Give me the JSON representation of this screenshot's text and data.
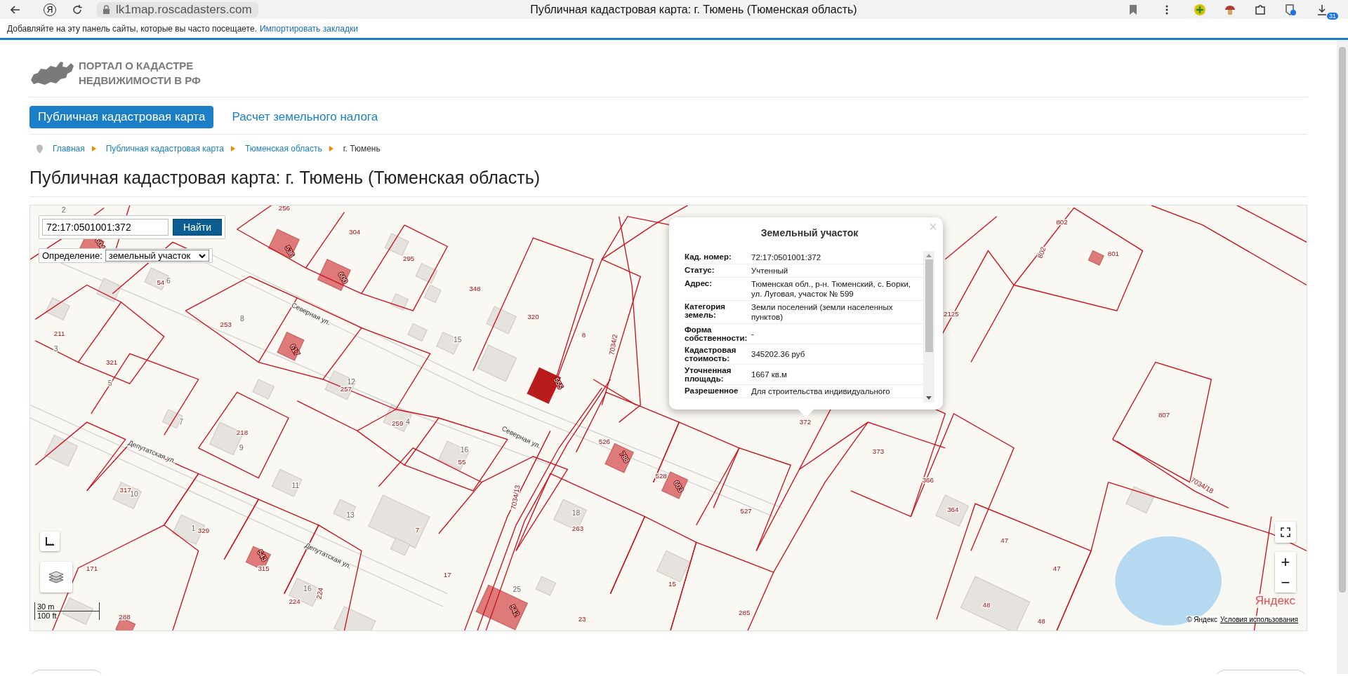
{
  "browser": {
    "yandex_glyph": "Я",
    "url": "lk1map.roscadasters.com",
    "title": "Публичная кадастровая карта: г. Тюмень (Тюменская область)",
    "download_badge": "31"
  },
  "bookmarks_bar": {
    "hint": "Добавляйте на эту панель сайты, которые вы часто посещаете.",
    "link": "Импортировать закладки"
  },
  "logo": {
    "lines": [
      "ПОРТАЛ О КАДАСТРЕ",
      "НЕДВИЖИМОСТИ В РФ"
    ]
  },
  "tabs": [
    {
      "label": "Публичная кадастровая карта",
      "selected": true
    },
    {
      "label": "Расчет земельного налога",
      "selected": false
    }
  ],
  "breadcrumbs": [
    "Главная",
    "Публичная кадастровая карта",
    "Тюменская область",
    "г. Тюмень"
  ],
  "heading": "Публичная кадастровая карта: г. Тюмень (Тюменская область)",
  "map": {
    "search_value": "72:17:0501001:372",
    "search_button": "Найти",
    "definition_label": "Определение:",
    "definition_value": "земельный участок",
    "house_numbers": [
      "2",
      "6",
      "8",
      "15",
      "3",
      "5",
      "12",
      "7",
      "4",
      "9",
      "16",
      "11",
      "10",
      "18",
      "13",
      "1",
      "16",
      "25"
    ],
    "building_numbers": [
      "604",
      "536",
      "600",
      "617",
      "555",
      "788",
      "603",
      "543",
      "542"
    ],
    "parcel_numbers": [
      "256",
      "304",
      "295",
      "54",
      "348",
      "320",
      "8",
      "7034/2",
      "253",
      "211",
      "321",
      "257",
      "259",
      "372",
      "218",
      "55",
      "526",
      "373",
      "528",
      "366",
      "7034/13",
      "317",
      "527",
      "364",
      "263",
      "329",
      "7",
      "47",
      "171",
      "315",
      "47",
      "17",
      "15",
      "224",
      "224",
      "48",
      "285",
      "288",
      "23",
      "48",
      "802",
      "802",
      "801",
      "2125",
      "807",
      "7034/18"
    ],
    "street_labels": [
      "Северная ул.",
      "Северная ул.",
      "Депутатская ул.",
      "Депутатская ул."
    ],
    "scale_metric": "30 m",
    "scale_imperial": "100 ft",
    "zoom_in": "+",
    "zoom_out": "−",
    "logo": "Яндекс",
    "copyright": "© Яндекс",
    "terms_link": "Условия использования",
    "popup": {
      "close": "×",
      "title": "Земельный участок",
      "rows": [
        {
          "label": "Кад. номер:",
          "value": "72:17:0501001:372"
        },
        {
          "label": "Статус:",
          "value": "Учтенный"
        },
        {
          "label": "Адрес:",
          "value": "Тюменская обл., р-н. Тюменский, с. Борки, ул. Луговая, участок № 599"
        },
        {
          "label": "Категория земель:",
          "value": "Земли поселений (земли населенных пунктов)"
        },
        {
          "label": "Форма собственности:",
          "value": "-"
        },
        {
          "label": "Кадастровая стоимость:",
          "value": "345202.36 руб"
        },
        {
          "label": "Уточненная площадь:",
          "value": "1667 кв.м"
        },
        {
          "label": "Разрешенное",
          "value": "Для строительства индивидуального"
        }
      ]
    }
  }
}
